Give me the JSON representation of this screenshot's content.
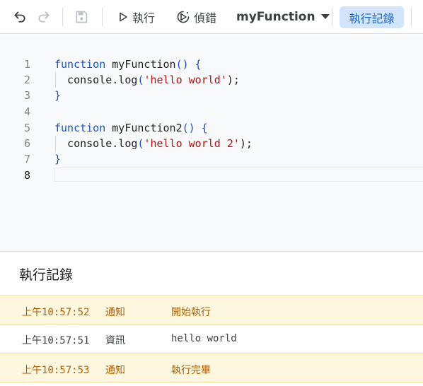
{
  "toolbar": {
    "undo_icon": "undo-icon",
    "redo_icon": "redo-icon",
    "save_icon": "save-icon",
    "run_label": "執行",
    "debug_label": "偵錯",
    "function_select": "myFunction",
    "log_toggle_label": "執行記錄"
  },
  "editor": {
    "lines": [
      {
        "number": "1",
        "tokens": [
          {
            "t": "function",
            "c": "kw"
          },
          {
            "t": " myFunction",
            "c": "fn"
          },
          {
            "t": "() {",
            "c": "pn"
          }
        ]
      },
      {
        "number": "2",
        "tokens": [
          {
            "t": "  console.log",
            "c": "fn"
          },
          {
            "t": "(",
            "c": "pn"
          },
          {
            "t": "'hello world'",
            "c": "str"
          },
          {
            "t": ");",
            "c": "fn"
          }
        ]
      },
      {
        "number": "3",
        "tokens": [
          {
            "t": "}",
            "c": "pn"
          }
        ]
      },
      {
        "number": "4",
        "tokens": []
      },
      {
        "number": "5",
        "tokens": [
          {
            "t": "function",
            "c": "kw"
          },
          {
            "t": " myFunction2",
            "c": "fn"
          },
          {
            "t": "() {",
            "c": "pn"
          }
        ]
      },
      {
        "number": "6",
        "tokens": [
          {
            "t": "  console.log",
            "c": "fn"
          },
          {
            "t": "(",
            "c": "pn"
          },
          {
            "t": "'hello world 2'",
            "c": "str"
          },
          {
            "t": ");",
            "c": "fn"
          }
        ]
      },
      {
        "number": "7",
        "tokens": [
          {
            "t": "}",
            "c": "pn"
          }
        ]
      },
      {
        "number": "8",
        "tokens": []
      }
    ]
  },
  "log": {
    "title": "執行記錄",
    "entries": [
      {
        "time": "上午10:57:52",
        "type": "通知",
        "message": "開始執行",
        "level": "notice"
      },
      {
        "time": "上午10:57:51",
        "type": "資訊",
        "message": "hello world",
        "level": "info"
      },
      {
        "time": "上午10:57:53",
        "type": "通知",
        "message": "執行完畢",
        "level": "notice"
      }
    ]
  },
  "colors": {
    "accent": "#1967d2",
    "accent_bg": "#d2e3fc",
    "notice_bg": "#fef7e0",
    "notice_text": "#b06000",
    "keyword": "#1a53c9",
    "string": "#b31412"
  }
}
